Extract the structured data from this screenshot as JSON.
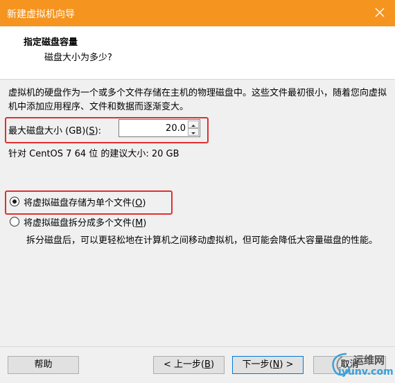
{
  "window": {
    "title": "新建虚拟机向导"
  },
  "header": {
    "title": "指定磁盘容量",
    "subtitle": "磁盘大小为多少?"
  },
  "description": "虚拟机的硬盘作为一个或多个文件存储在主机的物理磁盘中。这些文件最初很小，随着您向虚拟机中添加应用程序、文件和数据而逐渐变大。",
  "disk_size": {
    "label_prefix": "最大磁盘大小 (GB)(",
    "label_key": "S",
    "label_suffix": "):",
    "value": "20.0"
  },
  "recommendation": "针对 CentOS 7 64 位 的建议大小: 20 GB",
  "options": {
    "single": {
      "label_prefix": "将虚拟磁盘存储为单个文件(",
      "key": "O",
      "label_suffix": ")",
      "selected": true
    },
    "split": {
      "label_prefix": "将虚拟磁盘拆分成多个文件(",
      "key": "M",
      "label_suffix": ")",
      "selected": false
    },
    "split_note": "拆分磁盘后，可以更轻松地在计算机之间移动虚拟机，但可能会降低大容量磁盘的性能。"
  },
  "buttons": {
    "help": "帮助",
    "back_prefix": "< 上一步(",
    "back_key": "B",
    "back_suffix": ")",
    "next_prefix": "下一步(",
    "next_key": "N",
    "next_suffix": ") >",
    "cancel": "取消"
  },
  "watermark": {
    "line1": "运维网",
    "line2": "iyunv.com"
  },
  "colors": {
    "titlebar": "#f5941f",
    "highlight": "#e0302f",
    "default_button_border": "#0078d7"
  }
}
